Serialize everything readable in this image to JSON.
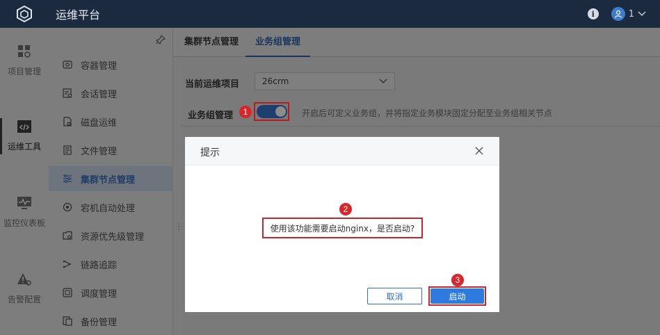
{
  "app": {
    "title": "运维平台"
  },
  "user": {
    "name": "1"
  },
  "iconbar": [
    {
      "label": "项目管理",
      "icon": "grid-icon"
    },
    {
      "label": "运维工具",
      "icon": "code-icon",
      "active": true
    },
    {
      "label": "监控仪表板",
      "icon": "monitor-icon"
    },
    {
      "label": "告警配置",
      "icon": "alert-icon"
    }
  ],
  "subnav": [
    {
      "label": "容器管理",
      "icon": "container-icon"
    },
    {
      "label": "会话管理",
      "icon": "session-icon"
    },
    {
      "label": "磁盘运维",
      "icon": "disk-icon"
    },
    {
      "label": "文件管理",
      "icon": "file-icon"
    },
    {
      "label": "集群节点管理",
      "icon": "cluster-icon",
      "active": true
    },
    {
      "label": "宕机自动处理",
      "icon": "recovery-icon"
    },
    {
      "label": "资源优先级管理",
      "icon": "priority-icon"
    },
    {
      "label": "链路追踪",
      "icon": "trace-icon"
    },
    {
      "label": "调度管理",
      "icon": "schedule-icon"
    },
    {
      "label": "备份管理",
      "icon": "backup-icon"
    }
  ],
  "tabs": [
    {
      "label": "集群节点管理"
    },
    {
      "label": "业务组管理",
      "active": true
    }
  ],
  "form": {
    "project_label": "当前运维项目",
    "project_value": "26crm",
    "group_label": "业务组管理",
    "group_enabled": true,
    "group_desc": "开启后可定义业务组，并将指定业务模块固定分配至业务组相关节点"
  },
  "markers": [
    "1",
    "2",
    "3"
  ],
  "dialog": {
    "title": "提示",
    "message": "使用该功能需要启动nginx，是否启动?",
    "cancel_label": "取消",
    "ok_label": "启动"
  },
  "colors": {
    "topbar": "#1c2a40",
    "primary": "#2e7be0",
    "marker": "#d8262c"
  }
}
